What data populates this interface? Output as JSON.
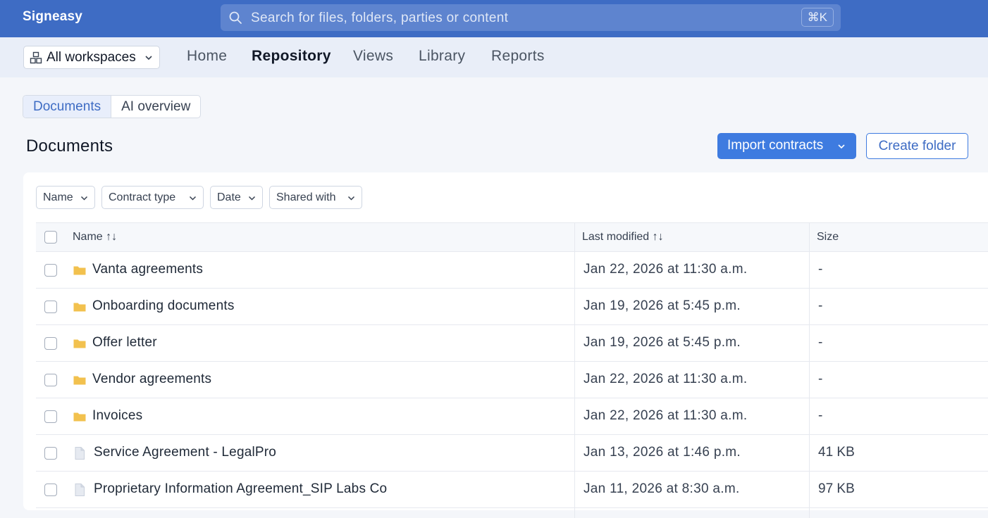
{
  "app": {
    "brand": "Signeasy"
  },
  "search": {
    "placeholder": "Search for files, folders, parties or content",
    "shortcut": "⌘K"
  },
  "workspace": {
    "label": "All workspaces"
  },
  "nav": {
    "home": "Home",
    "repository": "Repository",
    "views": "Views",
    "library": "Library",
    "reports": "Reports",
    "active": "Repository"
  },
  "tabs": {
    "documents": "Documents",
    "ai_overview": "AI overview",
    "active": "Documents"
  },
  "page": {
    "title": "Documents"
  },
  "actions": {
    "import_contracts": "Import contracts",
    "create_folder": "Create folder"
  },
  "filters": {
    "name": "Name",
    "contract_type": "Contract type",
    "date": "Date",
    "shared_with": "Shared with"
  },
  "table": {
    "columns": {
      "name": "Name ↑↓",
      "last_modified": "Last modified ↑↓",
      "size": "Size"
    },
    "rows": [
      {
        "type": "folder",
        "name": "Vanta agreements",
        "modified": "Jan 22, 2026 at 11:30 a.m.",
        "size": "-"
      },
      {
        "type": "folder",
        "name": "Onboarding documents",
        "modified": "Jan 19, 2026 at 5:45 p.m.",
        "size": "-"
      },
      {
        "type": "folder",
        "name": "Offer letter",
        "modified": "Jan 19, 2026 at 5:45 p.m.",
        "size": "-"
      },
      {
        "type": "folder",
        "name": "Vendor agreements",
        "modified": "Jan 22, 2026 at 11:30 a.m.",
        "size": "-"
      },
      {
        "type": "folder",
        "name": "Invoices",
        "modified": "Jan 22, 2026 at 11:30 a.m.",
        "size": "-"
      },
      {
        "type": "file",
        "name": "Service Agreement - LegalPro",
        "modified": "Jan 13, 2026 at 1:46 p.m.",
        "size": "41 KB"
      },
      {
        "type": "file",
        "name": "Proprietary Information Agreement_SIP Labs Co",
        "modified": "Jan 11, 2026 at 8:30 a.m.",
        "size": "97 KB"
      }
    ]
  },
  "colors": {
    "topbar": "#3e6cc4",
    "accent": "#3e7be0",
    "folder": "#f2c14e"
  }
}
